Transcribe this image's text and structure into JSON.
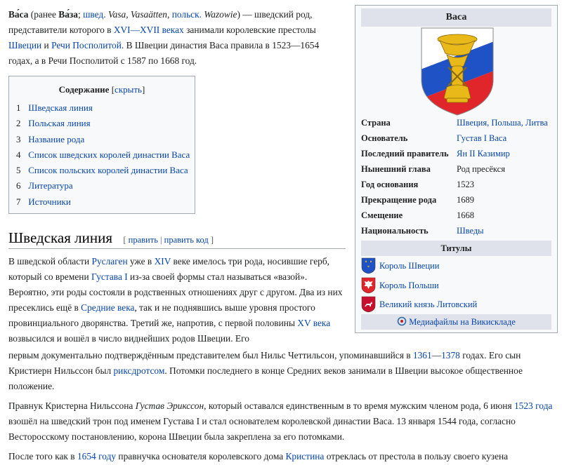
{
  "intro": {
    "name": "Ва́са",
    "before_alt": "(ранее ",
    "alt_name": "Ва́за",
    "sep1": "; ",
    "lang_sv": "швед.",
    "name_sv": "Vasa, Vasaätten",
    "sep2": ", ",
    "lang_pl": "польск.",
    "name_pl": "Wazowie",
    "after_names": ") — шведский род, представители которого в ",
    "link_centuries": "XVI—XVII веках",
    "t1": " занимали королевские престолы ",
    "link_sweden": "Швеции",
    "t2": " и ",
    "link_rzecz": "Речи Посполитой",
    "t3": ". В Швеции династия Васа правила в 1523—1654 годах, а в Речи Посполитой с 1587 по 1668 год."
  },
  "toc": {
    "title": "Содержание",
    "toggle_label": "скрыть",
    "items": [
      {
        "num": "1",
        "label": "Шведская линия"
      },
      {
        "num": "2",
        "label": "Польская линия"
      },
      {
        "num": "3",
        "label": "Название рода"
      },
      {
        "num": "4",
        "label": "Список шведских королей династии Васа"
      },
      {
        "num": "5",
        "label": "Список польских королей династии Васа"
      },
      {
        "num": "6",
        "label": "Литература"
      },
      {
        "num": "7",
        "label": "Источники"
      }
    ]
  },
  "section": {
    "heading": "Шведская линия",
    "edit_open": "[ ",
    "edit_label": "править",
    "edit_sep": " | ",
    "edit_code_label": "править код",
    "edit_close": " ]"
  },
  "p1": {
    "t1": "В шведской области ",
    "l1": "Руслаген",
    "t2": " уже в ",
    "l2": "XIV",
    "t3": " веке имелось три рода, носившие герб, который со времени ",
    "l3": "Густава I",
    "t4": " из-за своей формы стал называться «вазой». Вероятно, эти роды состояли в родственных отношениях друг с другом. Два из них пресеклись ещё в ",
    "l4": "Средние века",
    "t5": ", так и не поднявшись выше уровня простого провинциального дворянства. Третий же, напротив, с первой половины ",
    "l5": "XV века",
    "t6": " возвысился и вошёл в число виднейших родов Швеции. Его"
  },
  "p1b": {
    "t1": "первым документально подтверждённым представителем был Нильс Четтильсон, упоминавшийся в ",
    "l1": "1361",
    "dash": "—",
    "l2": "1378",
    "t2": " годах. Его сын Кристиерн Нильссон был ",
    "l3": "риксдротсом",
    "t3": ". Потомки последнего в конце Средних веков занимали в Швеции высокое общественное положение."
  },
  "p2": {
    "t1": "Правнук Кристерна Нильссона ",
    "italic": "Густав Эрикссон",
    "t2": ", который оставался единственным в то время мужским членом рода, 6 июня ",
    "l1": "1523 года",
    "t3": " взошёл на шведский трон под именем Густава I и стал основателем королевской династии Васа. 13 января 1544 года, согласно Весторосскому постановлению, корона Швеции была закреплена за его потомками."
  },
  "p3": {
    "t1": "После того как в ",
    "l1": "1654 году",
    "t2": " правнучка основателя королевского дома ",
    "l2": "Кристина",
    "t3": " отреклась от престола в пользу своего кузена"
  },
  "infobox": {
    "title": "Васа",
    "rows": [
      {
        "key": "Страна",
        "value": "Швеция, Польша, Литва",
        "link": true
      },
      {
        "key": "Основатель",
        "value": "Густав I Васа",
        "link": true
      },
      {
        "key": "Последний правитель",
        "value": "Ян II Казимир",
        "link": true
      },
      {
        "key": "Нынешний глава",
        "value": "Род пресёкся",
        "link": false
      },
      {
        "key": "Год основания",
        "value": "1523",
        "link": false
      },
      {
        "key": "Прекращение рода",
        "value": "1689",
        "link": false
      },
      {
        "key": "Смещение",
        "value": "1668",
        "link": false
      },
      {
        "key": "Национальность",
        "value": "Шведы",
        "link": true
      }
    ],
    "titles_heading": "Титулы",
    "titles": [
      {
        "label": "Король Швеции"
      },
      {
        "label": "Король Польши"
      },
      {
        "label": "Великий князь Литовский"
      }
    ],
    "commons_label": "Медиафайлы на Викискладе"
  },
  "colors": {
    "link": "#0645ad",
    "infobox_header": "#dfe2ea",
    "infobox_bg": "#f8f9fa",
    "border": "#a2a9b1",
    "coa_blue": "#1f52c4",
    "coa_red": "#e0262a",
    "coa_gold": "#e8b919"
  }
}
